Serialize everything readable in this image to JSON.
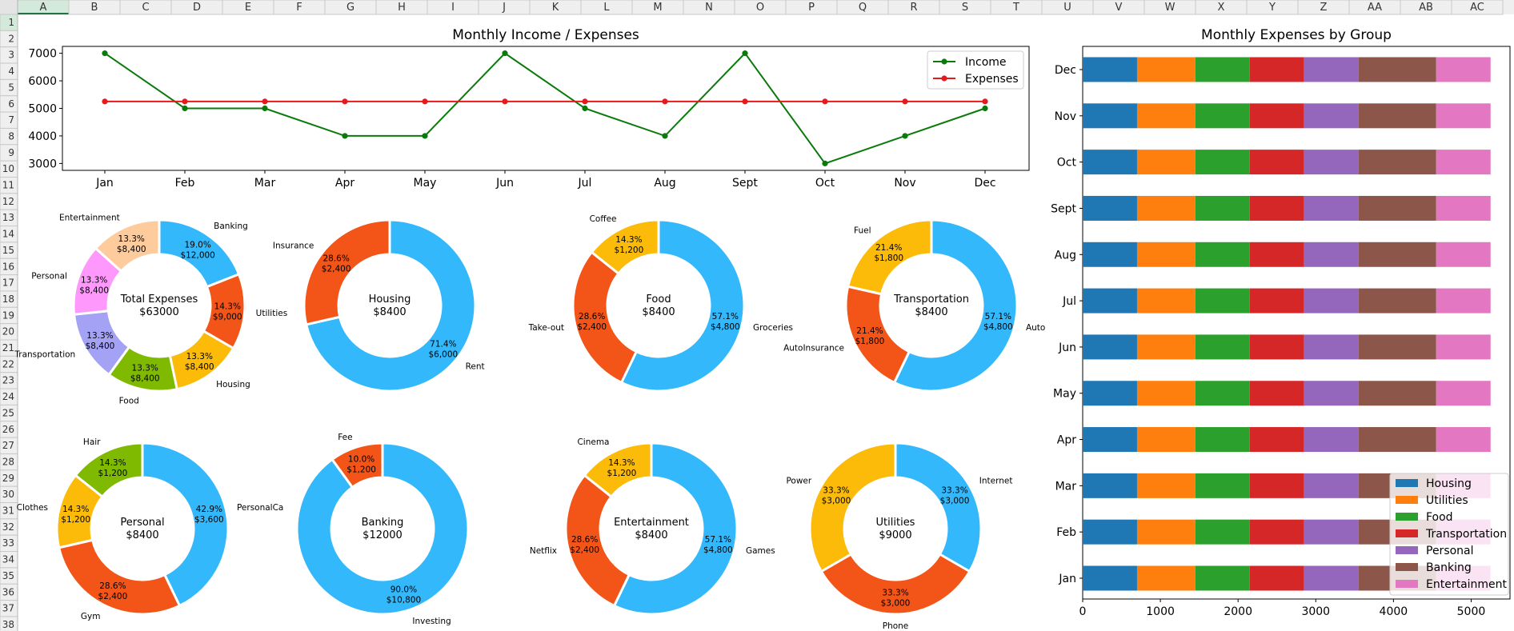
{
  "spreadsheet": {
    "columns": [
      "A",
      "B",
      "C",
      "D",
      "E",
      "F",
      "G",
      "H",
      "I",
      "J",
      "K",
      "L",
      "M",
      "N",
      "O",
      "P",
      "Q",
      "R",
      "S",
      "T",
      "U",
      "V",
      "W",
      "X",
      "Y",
      "Z",
      "AA",
      "AB",
      "AC"
    ],
    "rows": [
      "1",
      "2",
      "3",
      "4",
      "5",
      "6",
      "7",
      "8",
      "9",
      "10",
      "11",
      "12",
      "13",
      "14",
      "15",
      "16",
      "17",
      "18",
      "19",
      "20",
      "21",
      "22",
      "23",
      "24",
      "25",
      "26",
      "27",
      "28",
      "29",
      "30",
      "31",
      "32",
      "33",
      "34",
      "35",
      "36",
      "37",
      "38"
    ],
    "selected_column": "A",
    "selected_row": "1"
  },
  "chart_data": [
    {
      "id": "income-expenses",
      "type": "line",
      "title": "Monthly Income / Expenses",
      "categories": [
        "Jan",
        "Feb",
        "Mar",
        "Apr",
        "May",
        "Jun",
        "Jul",
        "Aug",
        "Sept",
        "Oct",
        "Nov",
        "Dec"
      ],
      "series": [
        {
          "name": "Income",
          "color": "#0a7a0a",
          "values": [
            7000,
            5000,
            5000,
            4000,
            4000,
            7000,
            5000,
            4000,
            7000,
            3000,
            4000,
            5000
          ]
        },
        {
          "name": "Expenses",
          "color": "#e41a1c",
          "values": [
            5250,
            5250,
            5250,
            5250,
            5250,
            5250,
            5250,
            5250,
            5250,
            5250,
            5250,
            5250
          ]
        }
      ],
      "ylim": [
        2750,
        7250
      ],
      "yticks": [
        3000,
        4000,
        5000,
        6000,
        7000
      ],
      "legend": "top-right"
    },
    {
      "id": "expenses-by-group",
      "type": "bar",
      "orientation": "horizontal-stacked",
      "title": "Monthly Expenses by Group",
      "categories": [
        "Jan",
        "Feb",
        "Mar",
        "Apr",
        "May",
        "Jun",
        "Jul",
        "Aug",
        "Sept",
        "Oct",
        "Nov",
        "Dec"
      ],
      "series": [
        {
          "name": "Housing",
          "color": "#1f77b4",
          "values": [
            700,
            700,
            700,
            700,
            700,
            700,
            700,
            700,
            700,
            700,
            700,
            700
          ]
        },
        {
          "name": "Utilities",
          "color": "#ff7f0e",
          "values": [
            750,
            750,
            750,
            750,
            750,
            750,
            750,
            750,
            750,
            750,
            750,
            750
          ]
        },
        {
          "name": "Food",
          "color": "#2ca02c",
          "values": [
            700,
            700,
            700,
            700,
            700,
            700,
            700,
            700,
            700,
            700,
            700,
            700
          ]
        },
        {
          "name": "Transportation",
          "color": "#d62728",
          "values": [
            700,
            700,
            700,
            700,
            700,
            700,
            700,
            700,
            700,
            700,
            700,
            700
          ]
        },
        {
          "name": "Personal",
          "color": "#9467bd",
          "values": [
            700,
            700,
            700,
            700,
            700,
            700,
            700,
            700,
            700,
            700,
            700,
            700
          ]
        },
        {
          "name": "Banking",
          "color": "#8c564b",
          "values": [
            1000,
            1000,
            1000,
            1000,
            1000,
            1000,
            1000,
            1000,
            1000,
            1000,
            1000,
            1000
          ]
        },
        {
          "name": "Entertainment",
          "color": "#e377c2",
          "values": [
            700,
            700,
            700,
            700,
            700,
            700,
            700,
            700,
            700,
            700,
            700,
            700
          ]
        }
      ],
      "xlim": [
        0,
        5500
      ],
      "xticks": [
        0,
        1000,
        2000,
        3000,
        4000,
        5000
      ],
      "legend": "bottom-right"
    },
    {
      "id": "donut-total",
      "type": "pie",
      "center_label": "Total Expenses",
      "center_value": "$63000",
      "slices": [
        {
          "label": "Banking",
          "pct": "19.0%",
          "amount": "$12,000",
          "value": 12000,
          "color": "#33b8fb"
        },
        {
          "label": "Utilities",
          "pct": "14.3%",
          "amount": "$9,000",
          "value": 9000,
          "color": "#f35418"
        },
        {
          "label": "Housing",
          "pct": "13.3%",
          "amount": "$8,400",
          "value": 8400,
          "color": "#fbbb08"
        },
        {
          "label": "Food",
          "pct": "13.3%",
          "amount": "$8,400",
          "value": 8400,
          "color": "#7fba00"
        },
        {
          "label": "Transportation",
          "pct": "13.3%",
          "amount": "$8,400",
          "value": 8400,
          "color": "#a4a2f5"
        },
        {
          "label": "Personal",
          "pct": "13.3%",
          "amount": "$8,400",
          "value": 8400,
          "color": "#fe98fc"
        },
        {
          "label": "Entertainment",
          "pct": "13.3%",
          "amount": "$8,400",
          "value": 8400,
          "color": "#fdcb9c"
        }
      ]
    },
    {
      "id": "donut-housing",
      "type": "pie",
      "center_label": "Housing",
      "center_value": "$8400",
      "slices": [
        {
          "label": "Rent",
          "pct": "71.4%",
          "amount": "$6,000",
          "value": 6000,
          "color": "#33b8fb"
        },
        {
          "label": "Insurance",
          "pct": "28.6%",
          "amount": "$2,400",
          "value": 2400,
          "color": "#f35418"
        }
      ]
    },
    {
      "id": "donut-food",
      "type": "pie",
      "center_label": "Food",
      "center_value": "$8400",
      "slices": [
        {
          "label": "Groceries",
          "pct": "57.1%",
          "amount": "$4,800",
          "value": 4800,
          "color": "#33b8fb"
        },
        {
          "label": "Take-out",
          "pct": "28.6%",
          "amount": "$2,400",
          "value": 2400,
          "color": "#f35418"
        },
        {
          "label": "Coffee",
          "pct": "14.3%",
          "amount": "$1,200",
          "value": 1200,
          "color": "#fbbb08"
        }
      ]
    },
    {
      "id": "donut-transportation",
      "type": "pie",
      "center_label": "Transportation",
      "center_value": "$8400",
      "slices": [
        {
          "label": "Auto",
          "pct": "57.1%",
          "amount": "$4,800",
          "value": 4800,
          "color": "#33b8fb"
        },
        {
          "label": "AutoInsurance",
          "pct": "21.4%",
          "amount": "$1,800",
          "value": 1800,
          "color": "#f35418"
        },
        {
          "label": "Fuel",
          "pct": "21.4%",
          "amount": "$1,800",
          "value": 1800,
          "color": "#fbbb08"
        }
      ]
    },
    {
      "id": "donut-personal",
      "type": "pie",
      "center_label": "Personal",
      "center_value": "$8400",
      "slices": [
        {
          "label": "PersonalCa",
          "pct": "42.9%",
          "amount": "$3,600",
          "value": 3600,
          "color": "#33b8fb"
        },
        {
          "label": "Gym",
          "pct": "28.6%",
          "amount": "$2,400",
          "value": 2400,
          "color": "#f35418"
        },
        {
          "label": "Clothes",
          "pct": "14.3%",
          "amount": "$1,200",
          "value": 1200,
          "color": "#fbbb08"
        },
        {
          "label": "Hair",
          "pct": "14.3%",
          "amount": "$1,200",
          "value": 1200,
          "color": "#7fba00"
        }
      ]
    },
    {
      "id": "donut-banking",
      "type": "pie",
      "center_label": "Banking",
      "center_value": "$12000",
      "slices": [
        {
          "label": "Investing",
          "pct": "90.0%",
          "amount": "$10,800",
          "value": 10800,
          "color": "#33b8fb"
        },
        {
          "label": "Fee",
          "pct": "10.0%",
          "amount": "$1,200",
          "value": 1200,
          "color": "#f35418"
        }
      ]
    },
    {
      "id": "donut-entertainment",
      "type": "pie",
      "center_label": "Entertainment",
      "center_value": "$8400",
      "slices": [
        {
          "label": "Games",
          "pct": "57.1%",
          "amount": "$4,800",
          "value": 4800,
          "color": "#33b8fb"
        },
        {
          "label": "Netflix",
          "pct": "28.6%",
          "amount": "$2,400",
          "value": 2400,
          "color": "#f35418"
        },
        {
          "label": "Cinema",
          "pct": "14.3%",
          "amount": "$1,200",
          "value": 1200,
          "color": "#fbbb08"
        }
      ]
    },
    {
      "id": "donut-utilities",
      "type": "pie",
      "center_label": "Utilities",
      "center_value": "$9000",
      "slices": [
        {
          "label": "Internet",
          "pct": "33.3%",
          "amount": "$3,000",
          "value": 3000,
          "color": "#33b8fb"
        },
        {
          "label": "Phone",
          "pct": "33.3%",
          "amount": "$3,000",
          "value": 3000,
          "color": "#f35418"
        },
        {
          "label": "Power",
          "pct": "33.3%",
          "amount": "$3,000",
          "value": 3000,
          "color": "#fbbb08"
        }
      ]
    }
  ]
}
